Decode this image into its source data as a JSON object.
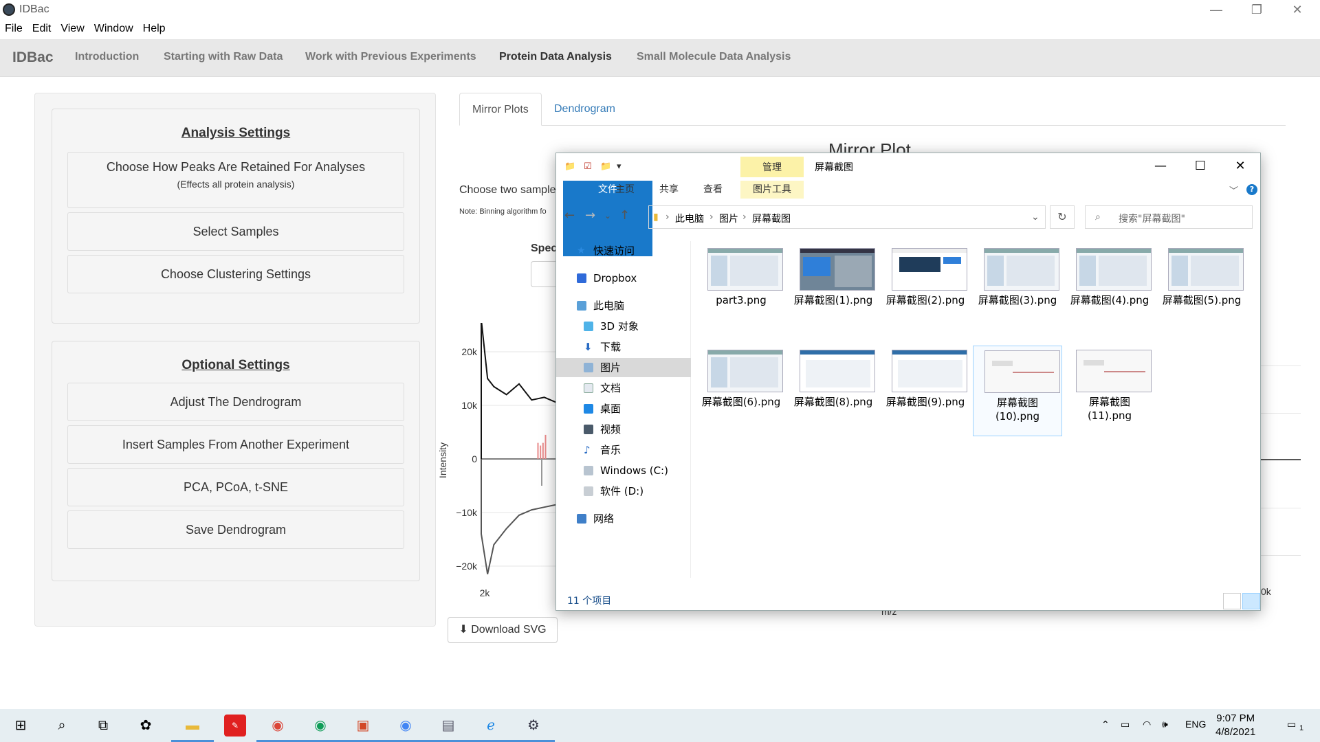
{
  "window": {
    "title": "IDBac",
    "controls": {
      "minimize": "—",
      "restore": "❐",
      "close": "✕"
    }
  },
  "menu": [
    "File",
    "Edit",
    "View",
    "Window",
    "Help"
  ],
  "navbar": {
    "brand": "IDBac",
    "links": [
      "Introduction",
      "Starting with Raw Data",
      "Work with Previous Experiments",
      "Protein Data Analysis",
      "Small Molecule Data Analysis"
    ],
    "active_link": "Protein Data Analysis"
  },
  "sidebar": {
    "analysis": {
      "title": "Analysis Settings",
      "peaks_label": "Choose How Peaks Are Retained For Analyses",
      "peaks_sub": "(Effects all protein analysis)",
      "samples_label": "Select Samples",
      "clustering_label": "Choose Clustering Settings"
    },
    "optional": {
      "title": "Optional Settings",
      "adjust_label": "Adjust The Dendrogram",
      "insert_label": "Insert Samples From Another Experiment",
      "pca_label": "PCA, PCoA, t-SNE",
      "save_label": "Save Dendrogram"
    }
  },
  "main": {
    "tabs": [
      "Mirror Plots",
      "Dendrogram"
    ],
    "active_tab": "Mirror Plots",
    "plot_title": "Mirror Plot",
    "choose_text": "Choose two sample",
    "note_text": "Note: Binning algorithm fo",
    "spec_label": "Spec",
    "download_label": "Download SVG",
    "xtick_right": "0k",
    "xlabel_partial": "m/z"
  },
  "chart_data": {
    "type": "line",
    "xlabel": "m/z",
    "ylabel": "Intensity",
    "yticks": [
      "20k",
      "10k",
      "0",
      "−10k",
      "−20k"
    ],
    "ylim": [
      -25000,
      27000
    ],
    "xticks": [
      "2k"
    ],
    "series": [
      {
        "x": [
          2000,
          2050,
          2100,
          2200,
          2300,
          2400,
          2500,
          2600
        ],
        "values": [
          26000,
          15000,
          13500,
          12000,
          14000,
          11000,
          11500,
          10500
        ]
      },
      {
        "x": [
          2000,
          2050,
          2100,
          2200,
          2300,
          2400,
          2500,
          2600
        ],
        "values": [
          -14000,
          -21500,
          -16000,
          -13000,
          -10500,
          -9500,
          -9000,
          -8500
        ]
      }
    ],
    "highlight_peaks": {
      "color": "#e88a8a",
      "x": [
        2450,
        2470,
        2490,
        2510
      ],
      "values": [
        3000,
        2500,
        3000,
        4500
      ]
    },
    "grid": true
  },
  "explorer": {
    "quick_access": [
      "📁",
      "☑",
      "📁",
      "▾"
    ],
    "manage_tab": "管理",
    "window_name": "屏幕截图",
    "ribbon": [
      "文件",
      "主页",
      "共享",
      "查看",
      "图片工具"
    ],
    "controls": {
      "minimize": "—",
      "maximize": "☐",
      "close": "✕"
    },
    "help": "?",
    "address": [
      "此电脑",
      "图片",
      "屏幕截图"
    ],
    "search_placeholder": "搜索\"屏幕截图\"",
    "nav_items": [
      "快速访问",
      "Dropbox",
      "此电脑",
      "3D 对象",
      "下载",
      "图片",
      "文档",
      "桌面",
      "视频",
      "音乐",
      "Windows (C:)",
      "软件 (D:)",
      "网络"
    ],
    "selected_nav": "图片",
    "files": [
      "part3.png",
      "屏幕截图(1).png",
      "屏幕截图(2).png",
      "屏幕截图(3).png",
      "屏幕截图(4).png",
      "屏幕截图(5).png",
      "屏幕截图(6).png",
      "屏幕截图(8).png",
      "屏幕截图(9).png",
      "屏幕截图\n(10).png",
      "屏幕截图\n(11).png"
    ],
    "selected_file": "屏幕截图\n(10).png",
    "status": "11 个项目"
  },
  "taskbar": {
    "tray_lang": "ENG",
    "time": "9:07 PM",
    "date": "4/8/2021",
    "notification_count": "1"
  }
}
